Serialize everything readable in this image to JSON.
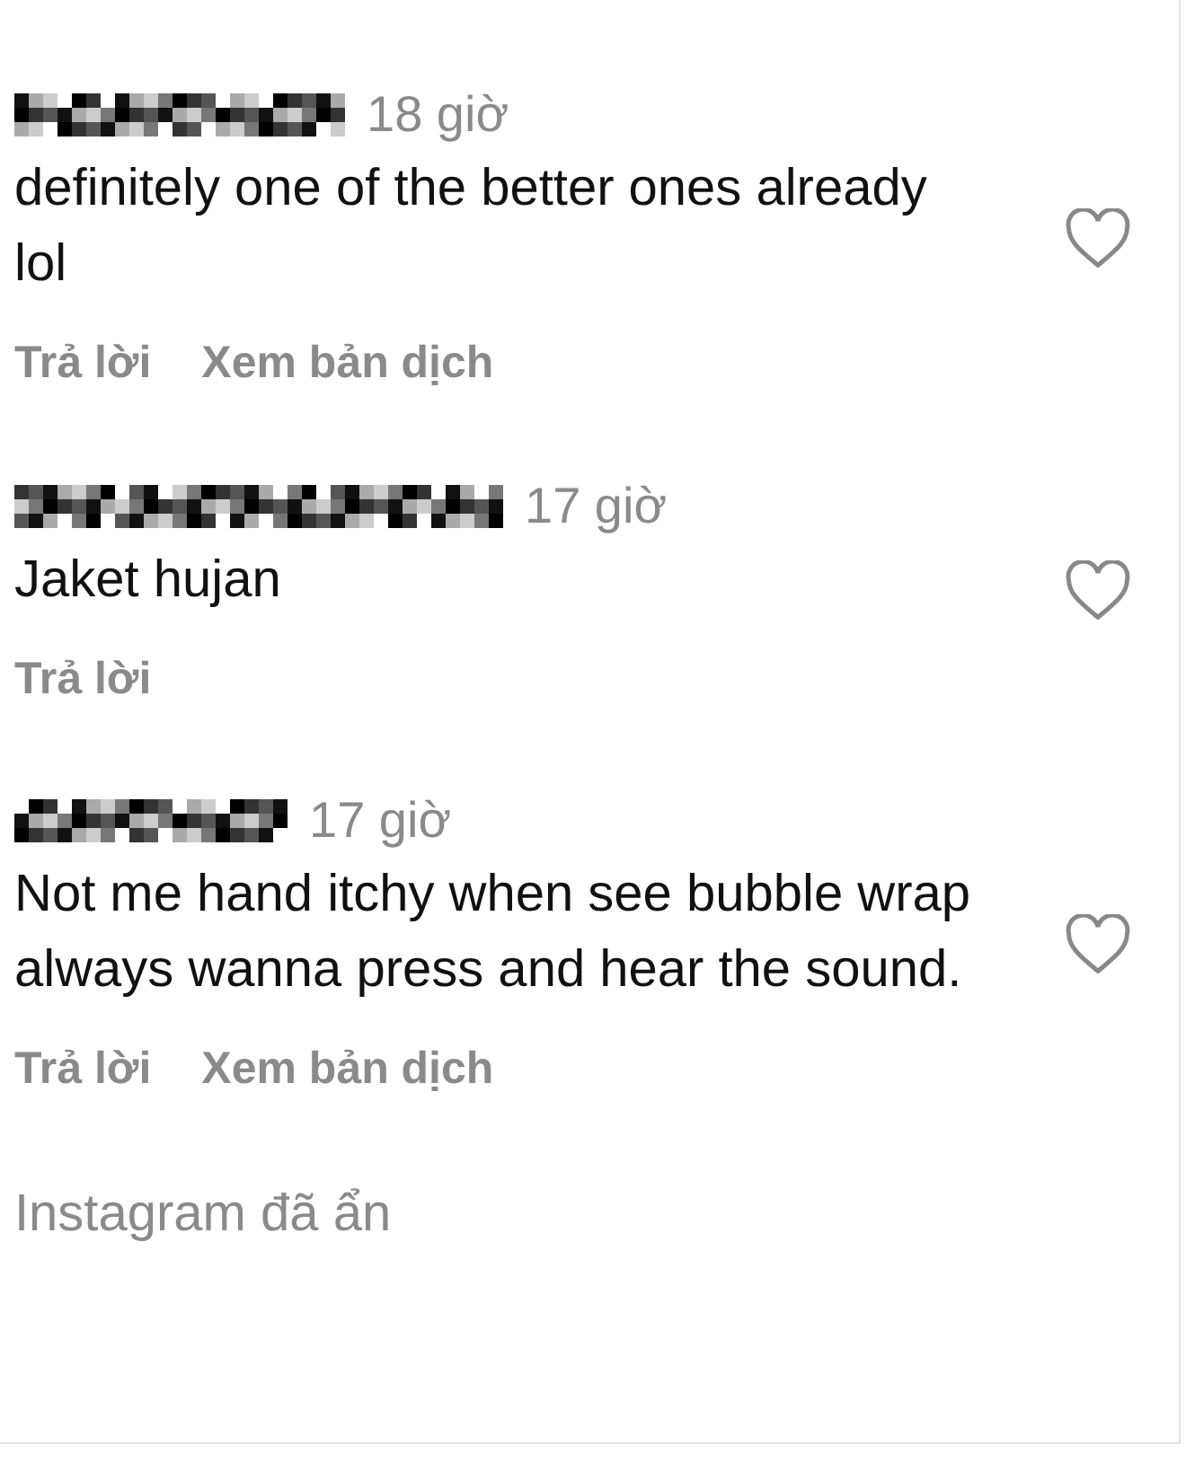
{
  "comments": [
    {
      "time": "18 giờ",
      "text": "definitely one of the better ones already lol",
      "liked": false,
      "actions": [
        "Trả lời",
        "Xem bản dịch"
      ]
    },
    {
      "time": "17 giờ",
      "text": "Jaket hujan",
      "liked": false,
      "actions": [
        "Trả lời"
      ]
    },
    {
      "time": "17 giờ",
      "text": "Not me hand itchy when see bubble wrap always wanna press and hear the sound.",
      "liked": false,
      "actions": [
        "Trả lời",
        "Xem bản dịch"
      ]
    }
  ],
  "hidden_note": "Instagram đã ẩn"
}
